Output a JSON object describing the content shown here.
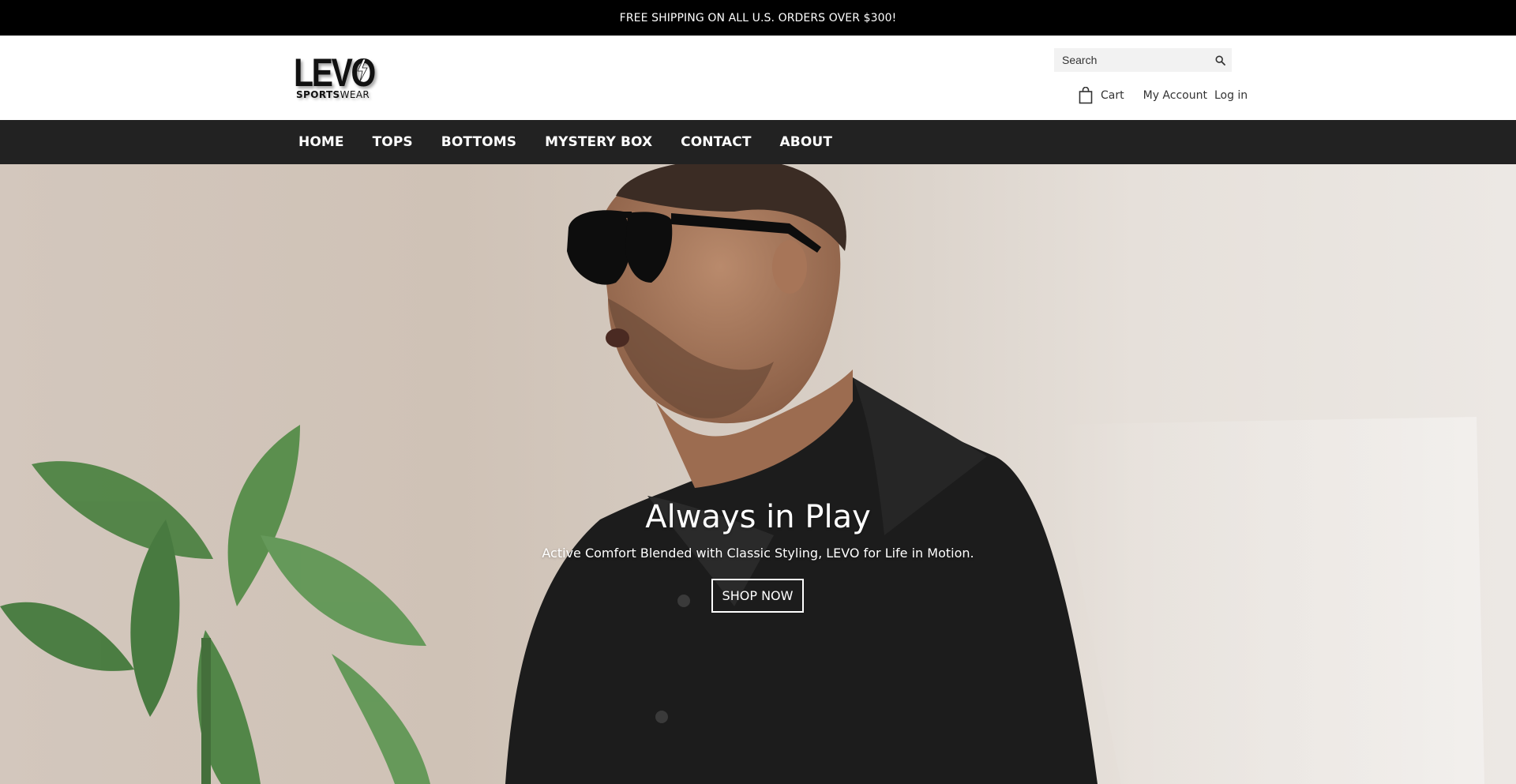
{
  "announcement": "FREE SHIPPING ON ALL U.S. ORDERS OVER $300!",
  "logo": {
    "main": "LEVO",
    "sub_bold": "SPORTS",
    "sub_light": "WEAR"
  },
  "search": {
    "placeholder": "Search",
    "icon": "magnifier-icon"
  },
  "account": {
    "cart_label": "Cart",
    "cart_icon": "shopping-bag-icon",
    "my_account": "My Account",
    "login": "Log in"
  },
  "nav": {
    "items": [
      "HOME",
      "TOPS",
      "BOTTOMS",
      "MYSTERY BOX",
      "CONTACT",
      "ABOUT"
    ]
  },
  "hero": {
    "title": "Always in Play",
    "subtitle": "Active Comfort Blended with Classic Styling, LEVO for Life in Motion.",
    "cta": "SHOP NOW"
  },
  "colors": {
    "announcement_bg": "#000000",
    "nav_bg": "#222222",
    "text_light": "#ffffff",
    "text_dark": "#333333"
  }
}
